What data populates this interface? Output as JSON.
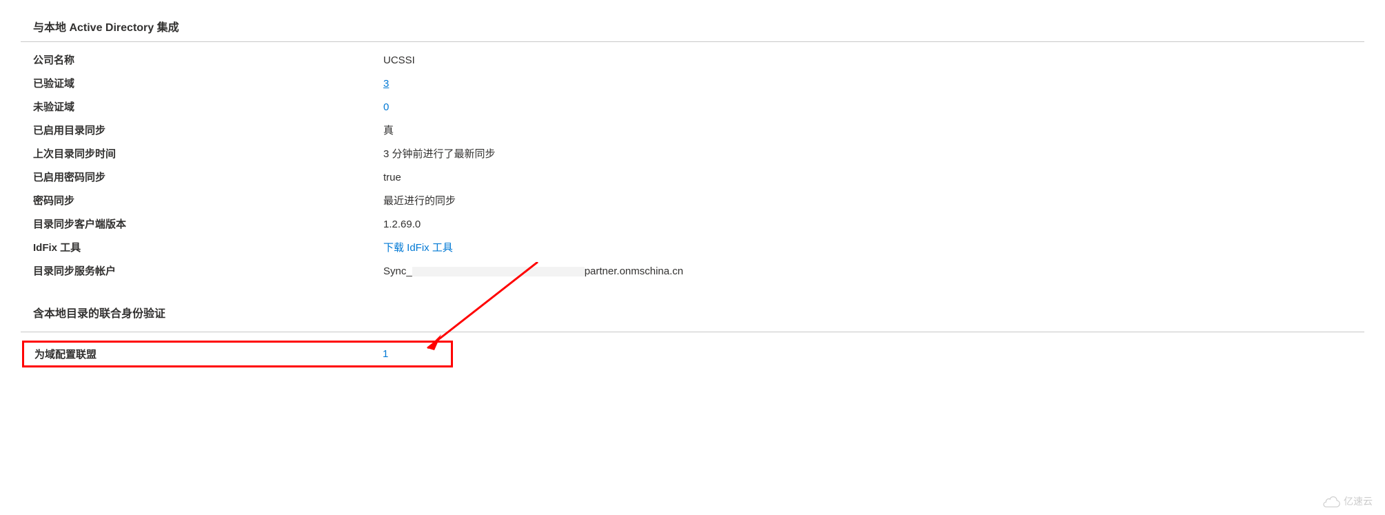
{
  "section1": {
    "title": "与本地 Active Directory 集成",
    "rows": [
      {
        "label": "公司名称",
        "value": "UCSSI",
        "type": "text"
      },
      {
        "label": "已验证域",
        "value": "3",
        "type": "link-underline"
      },
      {
        "label": "未验证域",
        "value": "0",
        "type": "link"
      },
      {
        "label": "已启用目录同步",
        "value": "真",
        "type": "text"
      },
      {
        "label": "上次目录同步时间",
        "value": "3 分钟前进行了最新同步",
        "type": "text"
      },
      {
        "label": "已启用密码同步",
        "value": "true",
        "type": "text"
      },
      {
        "label": "密码同步",
        "value": "最近进行的同步",
        "type": "text"
      },
      {
        "label": "目录同步客户端版本",
        "value": "1.2.69.0",
        "type": "text"
      },
      {
        "label": "IdFix 工具",
        "value": "下载 IdFix 工具",
        "type": "link"
      },
      {
        "label": "目录同步服务帐户",
        "value": "Sync_",
        "suffix": "partner.onmschina.cn",
        "type": "redacted"
      }
    ]
  },
  "section2": {
    "title": "含本地目录的联合身份验证"
  },
  "federation": {
    "label": "为域配置联盟",
    "value": "1"
  },
  "watermark": "亿速云"
}
